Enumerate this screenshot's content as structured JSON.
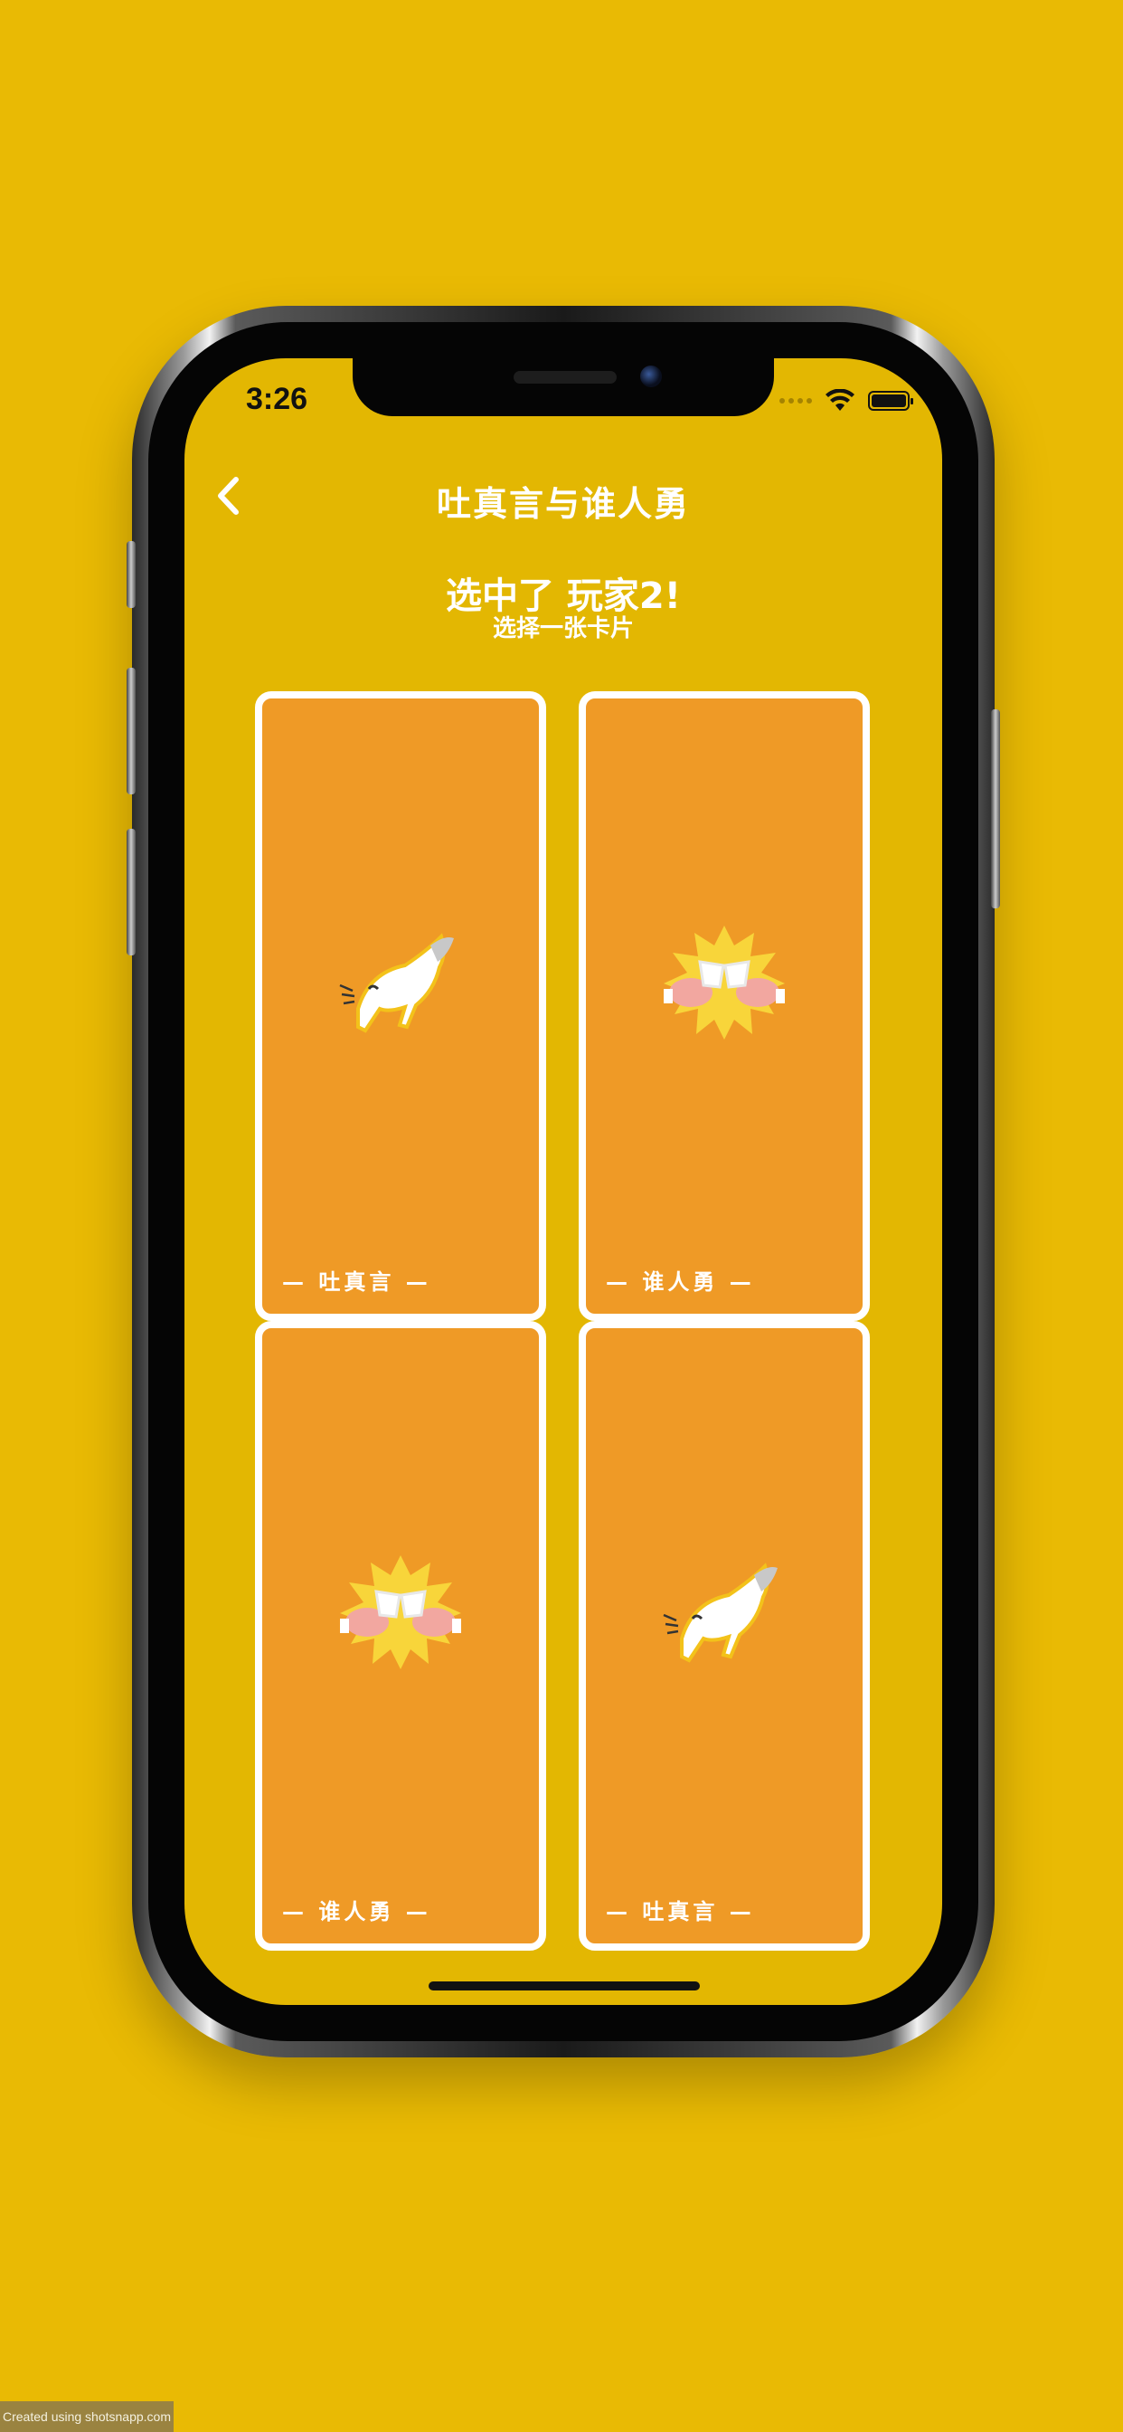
{
  "status_bar": {
    "time": "3:26"
  },
  "nav": {
    "title": "吐真言与谁人勇"
  },
  "selection": {
    "headline": "选中了 玩家2!",
    "subline": "选择一张卡片"
  },
  "cards": [
    {
      "label": "— 吐真言 —",
      "art": "cat-icon"
    },
    {
      "label": "— 谁人勇 —",
      "art": "cheers-icon"
    },
    {
      "label": "— 谁人勇 —",
      "art": "cheers-icon"
    },
    {
      "label": "— 吐真言 —",
      "art": "cat-icon"
    }
  ],
  "watermark": "Created using shotsnapp.com",
  "colors": {
    "background": "#E9BA04",
    "screen": "#E3B702",
    "card": "#EF9A26",
    "card_border": "#FFFFFF"
  }
}
